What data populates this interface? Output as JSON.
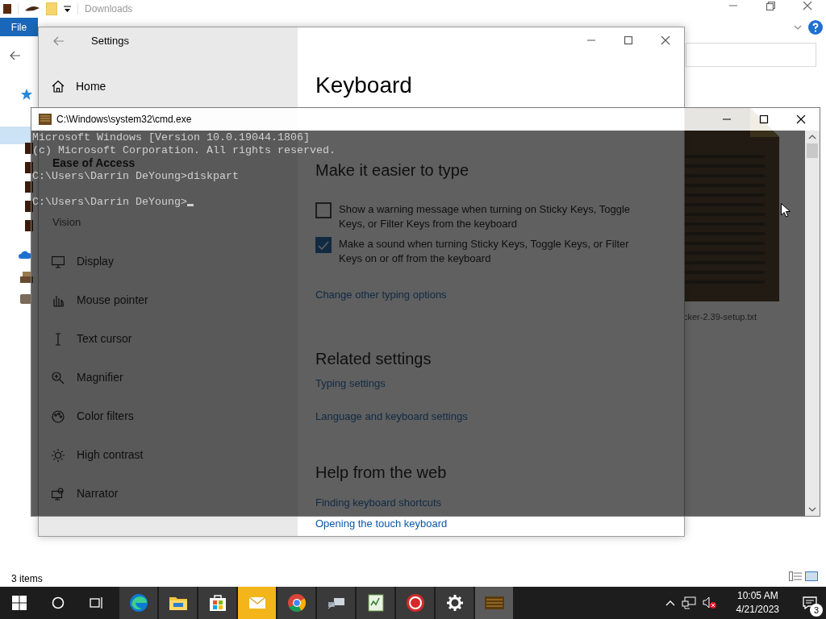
{
  "explorer": {
    "title": "Downloads",
    "ribbon_tab": "File",
    "file_label": "cker-2.39-setup.txt",
    "status": "3 items"
  },
  "settings": {
    "title": "Settings",
    "home": "Home",
    "section": "Ease of Access",
    "group": "Vision",
    "nav": [
      {
        "kind": "display",
        "label": "Display"
      },
      {
        "kind": "mouse",
        "label": "Mouse pointer"
      },
      {
        "kind": "text-cursor",
        "label": "Text cursor"
      },
      {
        "kind": "magnifier",
        "label": "Magnifier"
      },
      {
        "kind": "color-filters",
        "label": "Color filters"
      },
      {
        "kind": "high-contrast",
        "label": "High contrast"
      },
      {
        "kind": "narrator",
        "label": "Narrator"
      }
    ],
    "page_title": "Keyboard",
    "heading": "Make it easier to type",
    "options": [
      {
        "label": "Show a warning message when turning on Sticky Keys, Toggle Keys, or Filter Keys from the keyboard",
        "checked": false
      },
      {
        "label": "Make a sound when turning Sticky Keys, Toggle Keys, or Filter Keys on or off from the keyboard",
        "checked": true
      }
    ],
    "link": "Change other typing options",
    "related": {
      "heading": "Related settings",
      "links": [
        "Typing settings",
        "Language and keyboard settings"
      ]
    },
    "help": {
      "heading": "Help from the web",
      "links": [
        "Finding keyboard shortcuts",
        "Opening the touch keyboard"
      ]
    }
  },
  "console": {
    "title": "C:\\Windows\\system32\\cmd.exe",
    "blocks": [
      {
        "lines": [
          "Microsoft Windows [Version 10.0.19044.1806]",
          "(c) Microsoft Corporation. All rights reserved."
        ]
      },
      {
        "lines": [
          "C:\\Users\\Darrin DeYoung>diskpart"
        ]
      },
      {
        "lines": [
          "C:\\Users\\Darrin DeYoung>"
        ]
      }
    ]
  },
  "taskbar": {
    "apps": [
      {
        "kind": "edge",
        "active": false
      },
      {
        "kind": "folder",
        "active": false
      },
      {
        "kind": "store",
        "active": false
      },
      {
        "kind": "mail",
        "active": false
      },
      {
        "kind": "chrome",
        "active": false
      },
      {
        "kind": "network",
        "active": false
      },
      {
        "kind": "notepad",
        "active": false
      },
      {
        "kind": "red-app",
        "active": false
      },
      {
        "kind": "settings",
        "active": false
      },
      {
        "kind": "console",
        "active": true
      }
    ],
    "time": "10:05 AM",
    "date": "4/21/2023",
    "notifications": "3"
  }
}
